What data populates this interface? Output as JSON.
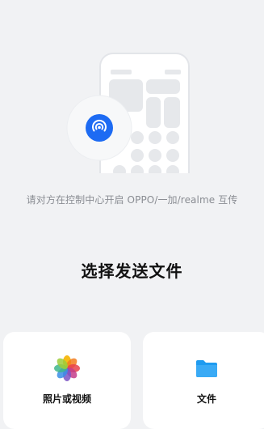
{
  "hint_text": "请对方在控制中心开启 OPPO/一加/realme 互传",
  "page_title": "选择发送文件",
  "options": [
    {
      "label": "照片或视频",
      "icon": "photos-icon"
    },
    {
      "label": "文件",
      "icon": "folder-icon"
    }
  ],
  "colors": {
    "background": "#f1f2f4",
    "accent": "#1d6bf3",
    "card": "#ffffff",
    "folder": "#1e9bf0"
  }
}
